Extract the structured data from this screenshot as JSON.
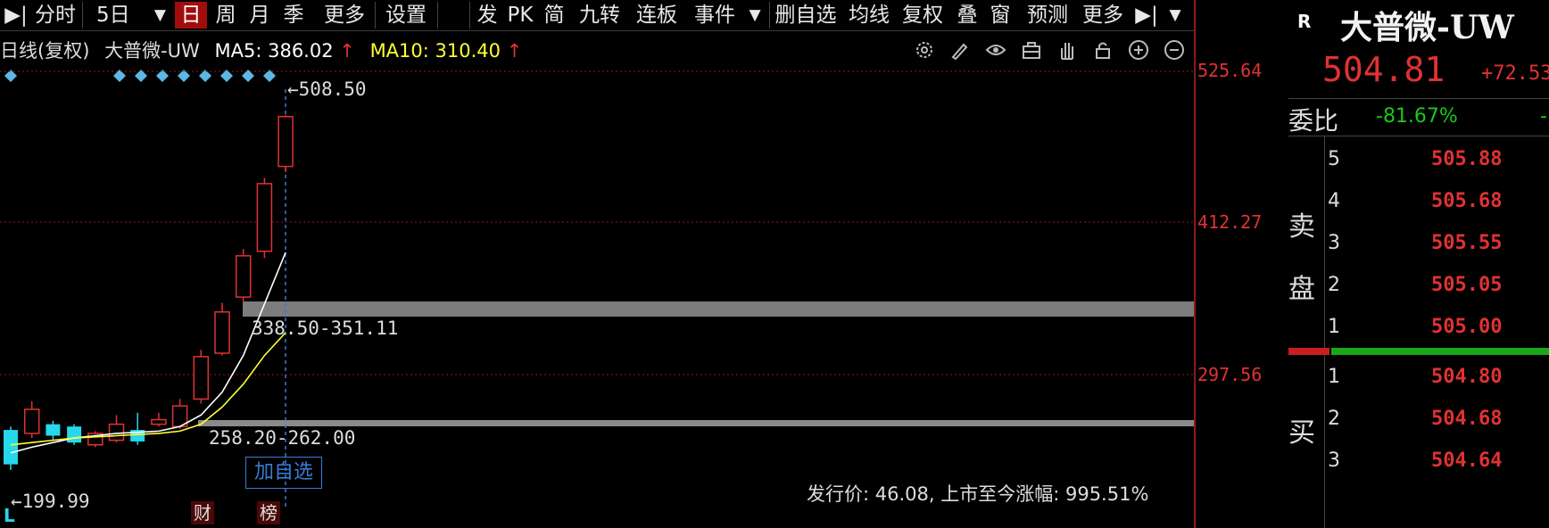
{
  "toolbar": {
    "items": [
      "分时",
      "5日",
      "日",
      "周",
      "月",
      "季",
      "更多",
      "设置",
      "发",
      "PK",
      "简",
      "九转",
      "连板",
      "事件",
      "删自选",
      "均线",
      "复权",
      "叠",
      "窗",
      "预测",
      "更多"
    ],
    "active": "日"
  },
  "subheader": {
    "period": "日线(复权)",
    "stock_name": "大普微-UW",
    "ma5_label": "MA5:",
    "ma5_value": "386.02",
    "ma10_label": "MA10:",
    "ma10_value": "310.40",
    "arrow": "↑"
  },
  "chart": {
    "y_ticks": [
      "525.64",
      "412.27",
      "297.56"
    ],
    "high_label": "508.50",
    "low_label": "199.99",
    "zone1_label": "338.50-351.11",
    "zone2_label": "258.20-262.00",
    "add_button": "加自选",
    "marker_L": "L",
    "marker_cai": "财",
    "marker_bang": "榜",
    "ipo_info": "发行价: 46.08, 上市至今涨幅: 995.51%"
  },
  "chart_data": {
    "type": "candlestick",
    "ylim": [
      165,
      548
    ],
    "candles": [
      {
        "open": 235,
        "close": 205,
        "high": 238,
        "low": 200
      },
      {
        "open": 232,
        "close": 253,
        "high": 260,
        "low": 228
      },
      {
        "open": 240,
        "close": 230,
        "high": 243,
        "low": 226
      },
      {
        "open": 238,
        "close": 224,
        "high": 240,
        "low": 222
      },
      {
        "open": 222,
        "close": 232,
        "high": 234,
        "low": 220
      },
      {
        "open": 226,
        "close": 240,
        "high": 248,
        "low": 224
      },
      {
        "open": 235,
        "close": 225,
        "high": 250,
        "low": 222
      },
      {
        "open": 240,
        "close": 244,
        "high": 250,
        "low": 238
      },
      {
        "open": 238,
        "close": 256,
        "high": 262,
        "low": 236
      },
      {
        "open": 262,
        "close": 299,
        "high": 305,
        "low": 258
      },
      {
        "open": 302,
        "close": 338,
        "high": 346,
        "low": 300
      },
      {
        "open": 351,
        "close": 387,
        "high": 393,
        "low": 346
      },
      {
        "open": 391,
        "close": 450,
        "high": 455,
        "low": 385
      },
      {
        "open": 465,
        "close": 508.5,
        "high": 510,
        "low": 460
      }
    ],
    "ma_white": [
      215,
      220,
      224,
      228,
      230,
      232,
      233,
      234,
      238,
      248,
      268,
      300,
      345,
      390
    ],
    "ma_yellow": [
      222,
      224,
      226,
      228,
      229,
      230,
      231,
      232,
      234,
      240,
      255,
      275,
      300,
      320
    ]
  },
  "panel": {
    "r_badge": "R",
    "name": "大普微-UW",
    "price": "504.81",
    "change": "+72.53",
    "wei_label": "委比",
    "wei_value": "-81.67%",
    "wei_extra": "-",
    "sell_label_1": "卖",
    "sell_label_2": "盘",
    "buy_label": "买",
    "sell": [
      {
        "level": "5",
        "price": "505.88"
      },
      {
        "level": "4",
        "price": "505.68"
      },
      {
        "level": "3",
        "price": "505.55"
      },
      {
        "level": "2",
        "price": "505.05"
      },
      {
        "level": "1",
        "price": "505.00"
      }
    ],
    "buy": [
      {
        "level": "1",
        "price": "504.80"
      },
      {
        "level": "2",
        "price": "504.68"
      },
      {
        "level": "3",
        "price": "504.64"
      }
    ]
  },
  "colors": {
    "up": "#e03232",
    "down": "#25d8ec",
    "ma5": "#ffffff",
    "ma10": "#ffff33",
    "accent": "#a10d0d",
    "green": "#19c819"
  },
  "icons": [
    "settings-icon",
    "pen-icon",
    "eye-icon",
    "toolbox-icon",
    "hand-icon",
    "lock-icon",
    "zoom-in-icon",
    "zoom-out-icon"
  ]
}
